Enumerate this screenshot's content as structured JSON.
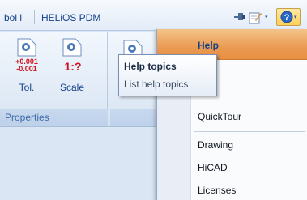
{
  "tabs": {
    "symbol_partial": "bol l",
    "pdm": "HELiOS PDM"
  },
  "quick_access": {
    "icons": [
      "pin-icon",
      "edit-note-icon",
      "help-icon"
    ],
    "caret": "▾"
  },
  "ribbon": {
    "group_properties_label": "Properties",
    "buttons": {
      "tol": {
        "label": "Tol.",
        "icon_text_top": "+0.001",
        "icon_text_bottom": "-0.001"
      },
      "scale": {
        "label": "Scale",
        "icon_text": "1:?"
      }
    }
  },
  "help_menu": {
    "header": "Help",
    "items": {
      "quicktour": "QuickTour",
      "drawing": "Drawing",
      "hicad": "HiCAD",
      "licenses": "Licenses"
    }
  },
  "tooltip": {
    "title": "Help topics",
    "description": "List help topics"
  },
  "colors": {
    "accent_text": "#15428b",
    "menu_highlight": "#ea9b52",
    "ribbon_bg": "#dde8f5"
  }
}
